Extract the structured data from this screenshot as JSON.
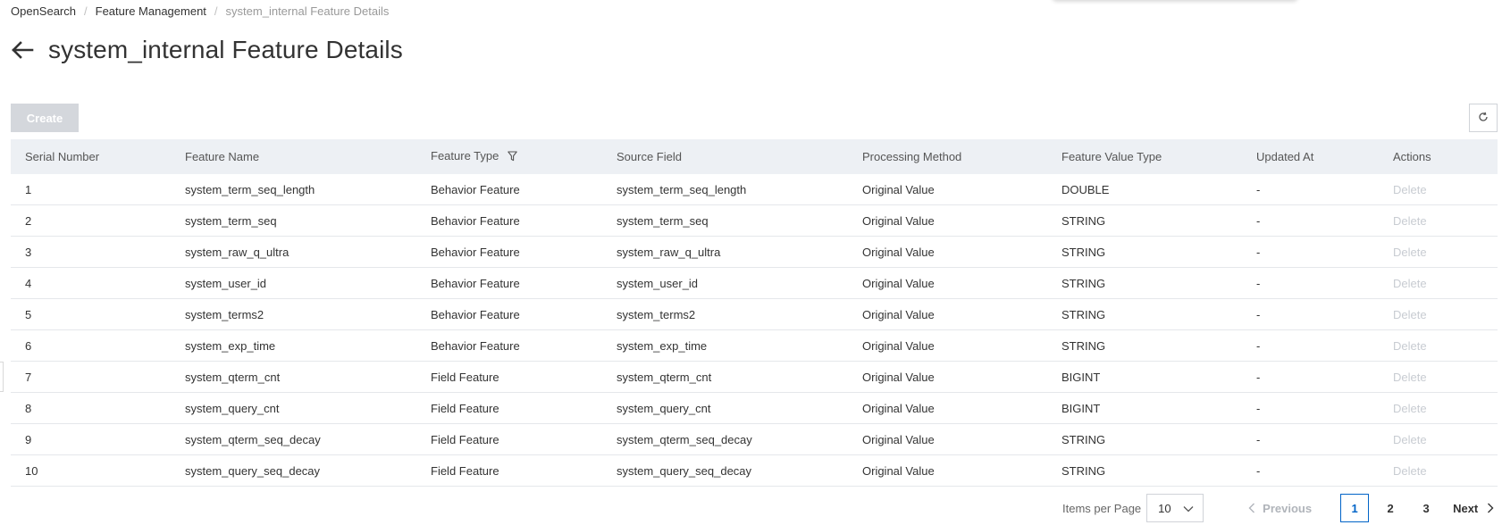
{
  "breadcrumb": {
    "items": [
      "OpenSearch",
      "Feature Management",
      "system_internal Feature Details"
    ],
    "separator": "/"
  },
  "page": {
    "title": "system_internal Feature Details",
    "back_icon": "arrow-left-icon"
  },
  "toolbar": {
    "create_label": "Create",
    "refresh_icon": "refresh-icon"
  },
  "table": {
    "columns": [
      "Serial Number",
      "Feature Name",
      "Feature Type",
      "Source Field",
      "Processing Method",
      "Feature Value Type",
      "Updated At",
      "Actions"
    ],
    "rows": [
      {
        "serial": "1",
        "name": "system_term_seq_length",
        "type": "Behavior Feature",
        "source": "system_term_seq_length",
        "method": "Original Value",
        "value_type": "DOUBLE",
        "updated": "-",
        "action": "Delete"
      },
      {
        "serial": "2",
        "name": "system_term_seq",
        "type": "Behavior Feature",
        "source": "system_term_seq",
        "method": "Original Value",
        "value_type": "STRING",
        "updated": "-",
        "action": "Delete"
      },
      {
        "serial": "3",
        "name": "system_raw_q_ultra",
        "type": "Behavior Feature",
        "source": "system_raw_q_ultra",
        "method": "Original Value",
        "value_type": "STRING",
        "updated": "-",
        "action": "Delete"
      },
      {
        "serial": "4",
        "name": "system_user_id",
        "type": "Behavior Feature",
        "source": "system_user_id",
        "method": "Original Value",
        "value_type": "STRING",
        "updated": "-",
        "action": "Delete"
      },
      {
        "serial": "5",
        "name": "system_terms2",
        "type": "Behavior Feature",
        "source": "system_terms2",
        "method": "Original Value",
        "value_type": "STRING",
        "updated": "-",
        "action": "Delete"
      },
      {
        "serial": "6",
        "name": "system_exp_time",
        "type": "Behavior Feature",
        "source": "system_exp_time",
        "method": "Original Value",
        "value_type": "STRING",
        "updated": "-",
        "action": "Delete"
      },
      {
        "serial": "7",
        "name": "system_qterm_cnt",
        "type": "Field Feature",
        "source": "system_qterm_cnt",
        "method": "Original Value",
        "value_type": "BIGINT",
        "updated": "-",
        "action": "Delete"
      },
      {
        "serial": "8",
        "name": "system_query_cnt",
        "type": "Field Feature",
        "source": "system_query_cnt",
        "method": "Original Value",
        "value_type": "BIGINT",
        "updated": "-",
        "action": "Delete"
      },
      {
        "serial": "9",
        "name": "system_qterm_seq_decay",
        "type": "Field Feature",
        "source": "system_qterm_seq_decay",
        "method": "Original Value",
        "value_type": "STRING",
        "updated": "-",
        "action": "Delete"
      },
      {
        "serial": "10",
        "name": "system_query_seq_decay",
        "type": "Field Feature",
        "source": "system_query_seq_decay",
        "method": "Original Value",
        "value_type": "STRING",
        "updated": "-",
        "action": "Delete"
      }
    ]
  },
  "pagination": {
    "items_per_page_label": "Items per Page",
    "items_per_page_value": "10",
    "previous_label": "Previous",
    "next_label": "Next",
    "pages": [
      "1",
      "2",
      "3"
    ],
    "current_page": "1"
  },
  "colors": {
    "accent": "#0064c8",
    "header_bg": "#edf0f4",
    "disabled_button": "#d4d7dc",
    "disabled_link": "#c8ccd2"
  }
}
